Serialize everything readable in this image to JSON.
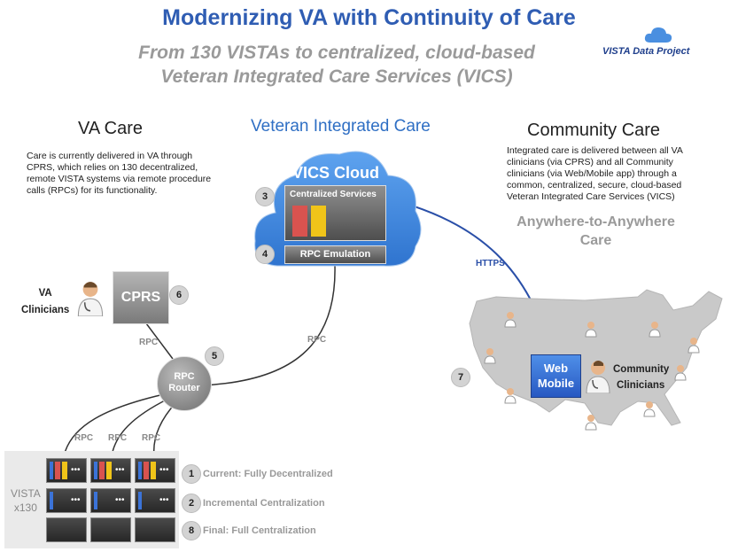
{
  "header": {
    "title": "Modernizing VA with Continuity of Care",
    "subtitle_line1": "From 130 VISTAs to centralized, cloud-based",
    "subtitle_line2": "Veteran Integrated Care Services (VICS)",
    "project_label": "VISTA Data Project"
  },
  "va_care": {
    "heading": "VA Care",
    "description": "Care is currently delivered in VA through CPRS, which relies on 130 decentralized, remote VISTA systems via remote procedure calls (RPCs) for its functionality."
  },
  "integrated": {
    "heading": "Veteran Integrated Care",
    "cloud_label": "VICS Cloud",
    "centralized_services": "Centralized Services",
    "rpc_emulation": "RPC Emulation"
  },
  "community_care": {
    "heading": "Community Care",
    "description": "Integrated care is delivered between all VA clinicians (via CPRS) and all Community clinicians  (via Web/Mobile app) through a common, centralized, secure, cloud-based Veteran Integrated Care Services  (VICS)",
    "tagline_line1": "Anywhere-to-Anywhere",
    "tagline_line2": "Care"
  },
  "nodes": {
    "va_clinicians_1": "VA",
    "va_clinicians_2": "Clinicians",
    "cprs": "CPRS",
    "router_1": "RPC",
    "router_2": "Router",
    "web_1": "Web",
    "web_2": "Mobile",
    "community_1": "Community",
    "community_2": "Clinicians",
    "vista_1": "VISTA",
    "vista_2": "x130"
  },
  "connections": {
    "https": "HTTPS",
    "rpc": "RPC"
  },
  "badges": {
    "b1": "1",
    "b2": "2",
    "b3": "3",
    "b4": "4",
    "b5": "5",
    "b6": "6",
    "b7": "7",
    "b8": "8"
  },
  "phases": {
    "p1": "Current: Fully Decentralized",
    "p2": "Incremental Centralization",
    "p3": "Final: Full Centralization"
  },
  "colors": {
    "title_blue": "#2f5db3",
    "cloud_blue": "#3f86d8",
    "https_line": "#2a4fa8",
    "bar_red": "#d9534f",
    "bar_yellow": "#f0c419",
    "bar_blue": "#3b73d8"
  }
}
